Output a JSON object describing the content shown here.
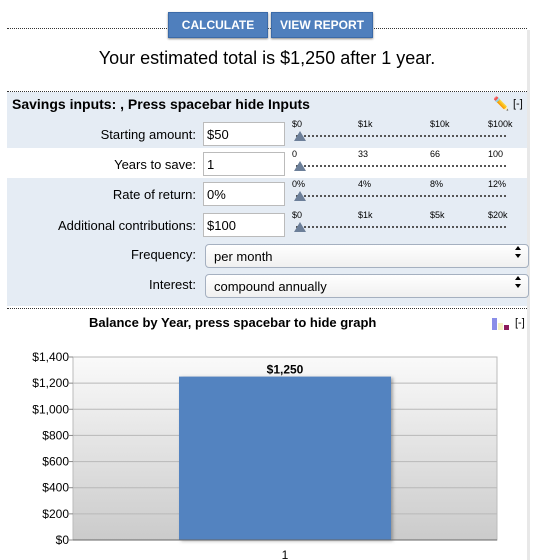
{
  "toolbar": {
    "calculate": "CALCULATE",
    "view_report": "VIEW REPORT"
  },
  "summary": "Your estimated total is $1,250 after 1 year.",
  "inputs": {
    "header": "Savings inputs: , Press spacebar hide Inputs",
    "collapse": "[-]",
    "rows": [
      {
        "label": "Starting amount:",
        "value": "$50",
        "ticks": [
          "$0",
          "$1k",
          "$10k",
          "$100k"
        ],
        "slider_level": 0
      },
      {
        "label": "Years to save:",
        "value": "1",
        "ticks": [
          "0",
          "33",
          "66",
          "100"
        ],
        "slider_level": 0
      },
      {
        "label": "Rate of return:",
        "value": "0%",
        "ticks": [
          "0%",
          "4%",
          "8%",
          "12%"
        ],
        "slider_level": 0
      },
      {
        "label": "Additional contributions:",
        "value": "$100",
        "ticks": [
          "$0",
          "$1k",
          "$5k",
          "$20k"
        ],
        "slider_level": 0
      }
    ],
    "frequency": {
      "label": "Frequency:",
      "value": "per month"
    },
    "interest": {
      "label": "Interest:",
      "value": "compound annually"
    }
  },
  "graph": {
    "header": "Balance by Year, press spacebar to hide graph",
    "collapse": "[-]"
  },
  "chart_data": {
    "type": "bar",
    "categories": [
      "1"
    ],
    "values": [
      1250
    ],
    "data_labels": [
      "$1,250"
    ],
    "ylim": [
      0,
      1400
    ],
    "yticks": [
      "$0",
      "$200",
      "$400",
      "$600",
      "$800",
      "$1,000",
      "$1,200",
      "$1,400"
    ],
    "grid": true,
    "bar_color": "#5383c0"
  },
  "colors": {
    "button": "#4f7fbd",
    "band": "#e5ecf4"
  }
}
